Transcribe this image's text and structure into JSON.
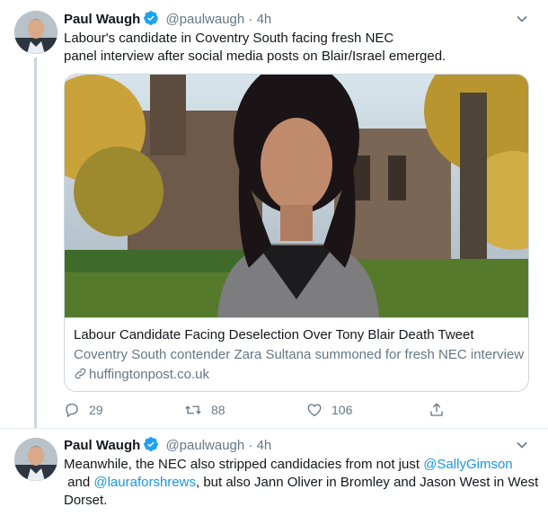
{
  "tweets": [
    {
      "author": {
        "name": "Paul Waugh",
        "handle": "@paulwaugh",
        "verified": true
      },
      "separator": "·",
      "time": "4h",
      "text_lines": [
        "Labour's candidate in Coventry South facing fresh NEC",
        "panel interview after social media posts on Blair/Israel emerged."
      ],
      "card": {
        "title": "Labour Candidate Facing Deselection Over Tony Blair Death Tweet",
        "description": "Coventry South contender Zara Sultana summoned for fresh NEC interview",
        "domain": "huffingtonpost.co.uk",
        "link_icon": "link-icon"
      },
      "actions": {
        "reply_count": "29",
        "retweet_count": "88",
        "like_count": "106"
      }
    },
    {
      "author": {
        "name": "Paul Waugh",
        "handle": "@paulwaugh",
        "verified": true
      },
      "separator": "·",
      "time": "4h",
      "text": {
        "line1_a": "Meanwhile, the NEC also stripped candidacies from not just ",
        "mention1": "@SallyGimson",
        "line2_a": " and ",
        "mention2": "@lauraforshrews",
        "line2_b": ", but also Jann Oliver in Bromley and Jason West in West",
        "line3": "Dorset."
      }
    }
  ],
  "colors": {
    "text": "#14171a",
    "secondary": "#657786",
    "link": "#1b95e0",
    "border": "#ccd6dd",
    "verified": "#1da1f2"
  }
}
